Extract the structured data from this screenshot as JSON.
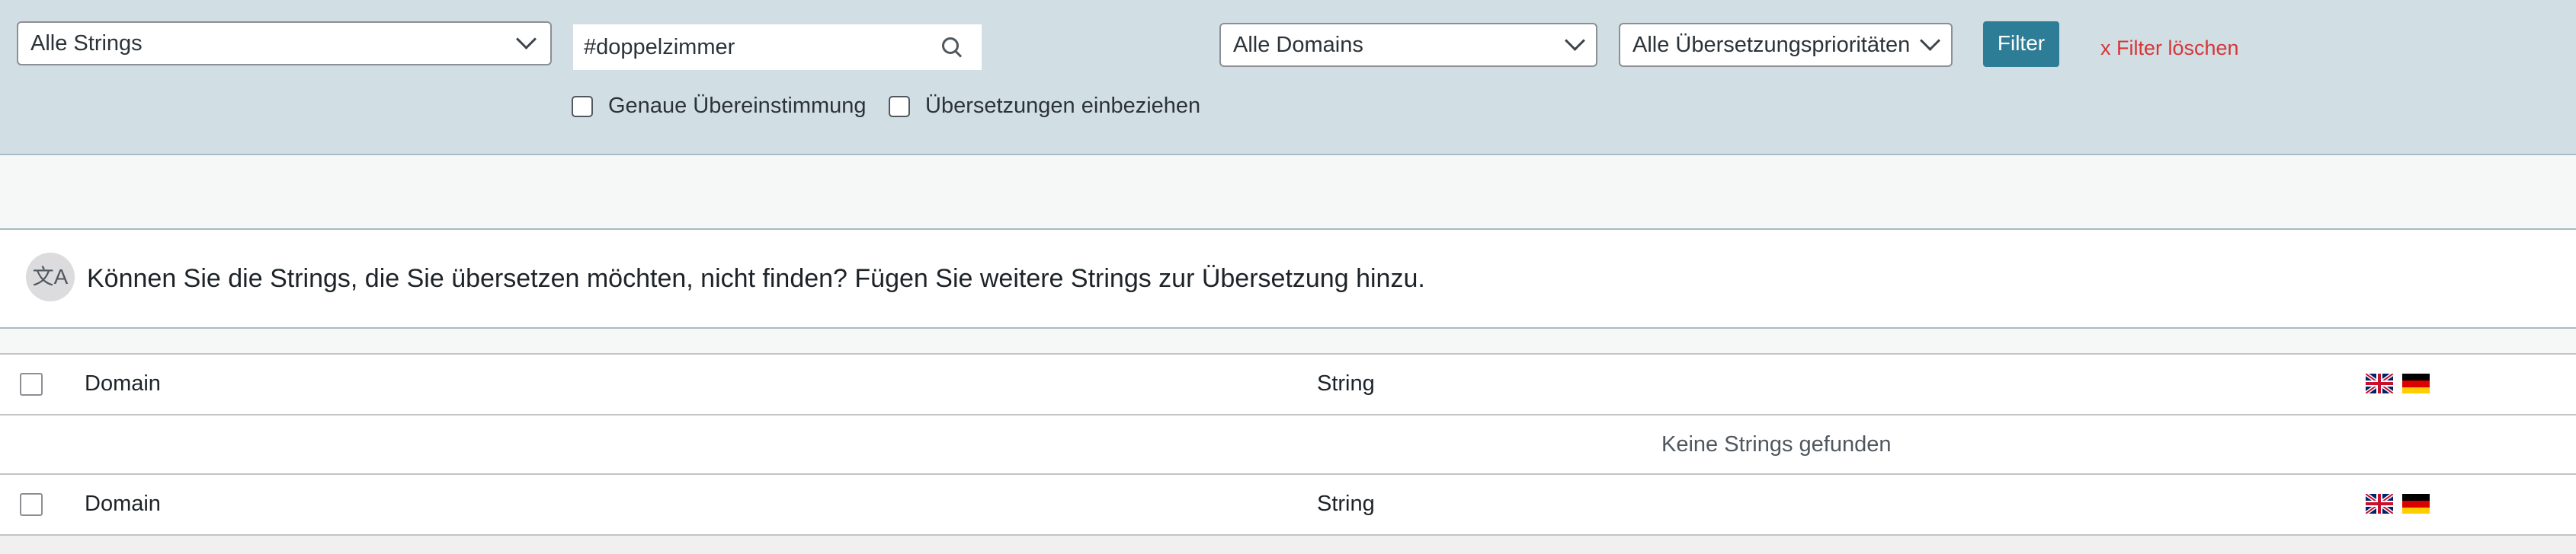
{
  "filters": {
    "strings_select": "Alle Strings",
    "search_value": "#doppelzimmer",
    "domains_select": "Alle Domains",
    "priority_select": "Alle Übersetzungsprioritäten",
    "filter_button": "Filter",
    "clear_filter": "x  Filter löschen",
    "exact_match_label": "Genaue Übereinstimmung",
    "include_translations_label": "Übersetzungen einbeziehen"
  },
  "notice": {
    "icon_text": "文A",
    "text": "Können Sie die Strings, die Sie übersetzen möchten, nicht finden? Fügen Sie weitere Strings zur Übersetzung hinzu."
  },
  "table": {
    "columns": [
      "Domain",
      "String"
    ],
    "empty_message": "Keine Strings gefunden",
    "flags": [
      "uk-flag-icon",
      "de-flag-icon"
    ]
  },
  "colors": {
    "filterbar_bg": "#d1dfe5",
    "filter_button": "#2e7d97",
    "clear_link": "#d63638"
  }
}
